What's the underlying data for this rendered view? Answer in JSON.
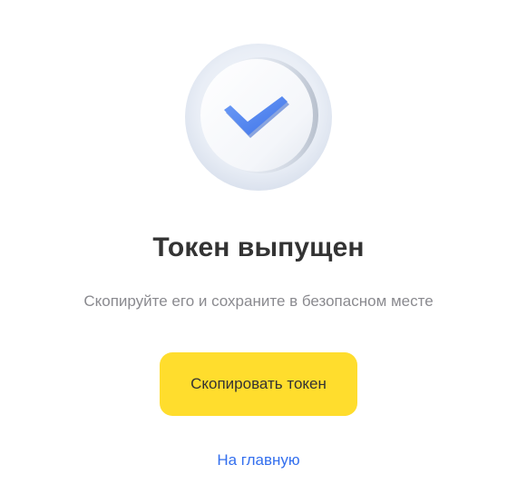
{
  "status": {
    "icon": "checkmark-badge-icon",
    "title": "Токен выпущен",
    "subtitle": "Скопируйте его и сохраните в безопасном месте"
  },
  "actions": {
    "copy_label": "Скопировать токен",
    "home_label": "На главную"
  },
  "colors": {
    "button_background": "#ffdd2d",
    "link": "#336fee",
    "checkmark": "#4f86f7"
  }
}
